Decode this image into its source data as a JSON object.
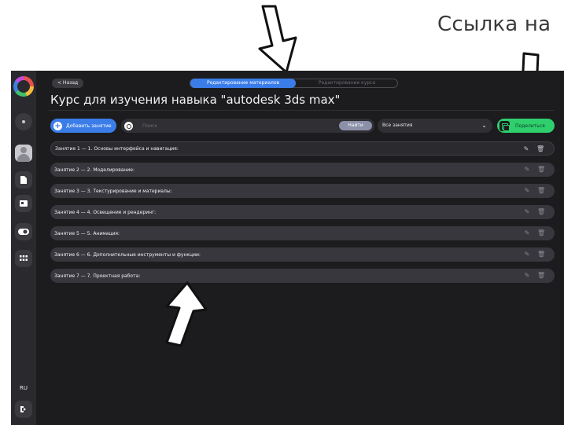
{
  "annotation": {
    "caption": "Ссылка на"
  },
  "sidebar": {
    "items": [
      {
        "icon": "logo-icon"
      },
      {
        "icon": "notification-icon"
      },
      {
        "icon": "avatar-icon"
      },
      {
        "icon": "document-icon"
      },
      {
        "icon": "id-card-icon"
      },
      {
        "icon": "toggle-icon"
      },
      {
        "icon": "grid-icon"
      }
    ],
    "language": "RU",
    "logout_icon": "logout-icon"
  },
  "header": {
    "back_label": "< Назад",
    "tabs": [
      {
        "label": "Редактирование материалов",
        "active": true
      },
      {
        "label": "Редактирование курса",
        "active": false
      }
    ],
    "title": "Курс для изучения навыка \"autodesk 3ds max\""
  },
  "toolbar": {
    "add_label": "Добавить занятие",
    "search_placeholder": "Поиск",
    "search_value": "",
    "find_label": "Найти",
    "filter_value": "Все занятия",
    "share_label": "Поделиться"
  },
  "lessons": [
    {
      "label": "Занятие 1 — 1. Основы интерфейса и навигация:"
    },
    {
      "label": "Занятие 2 — 2. Моделирование:"
    },
    {
      "label": "Занятие 3 — 3. Текстурирование и материалы:"
    },
    {
      "label": "Занятие 4 — 4. Освещение и рендеринг:"
    },
    {
      "label": "Занятие 5 — 5. Анимация:"
    },
    {
      "label": "Занятие 6 — 6. Дополнительные инструменты и функции:"
    },
    {
      "label": "Занятие 7 — 7. Проектная работа:"
    }
  ],
  "colors": {
    "accent_blue": "#3b7de8",
    "accent_green": "#2fcf6e",
    "background": "#1c1c1f",
    "row": "#37373d"
  }
}
